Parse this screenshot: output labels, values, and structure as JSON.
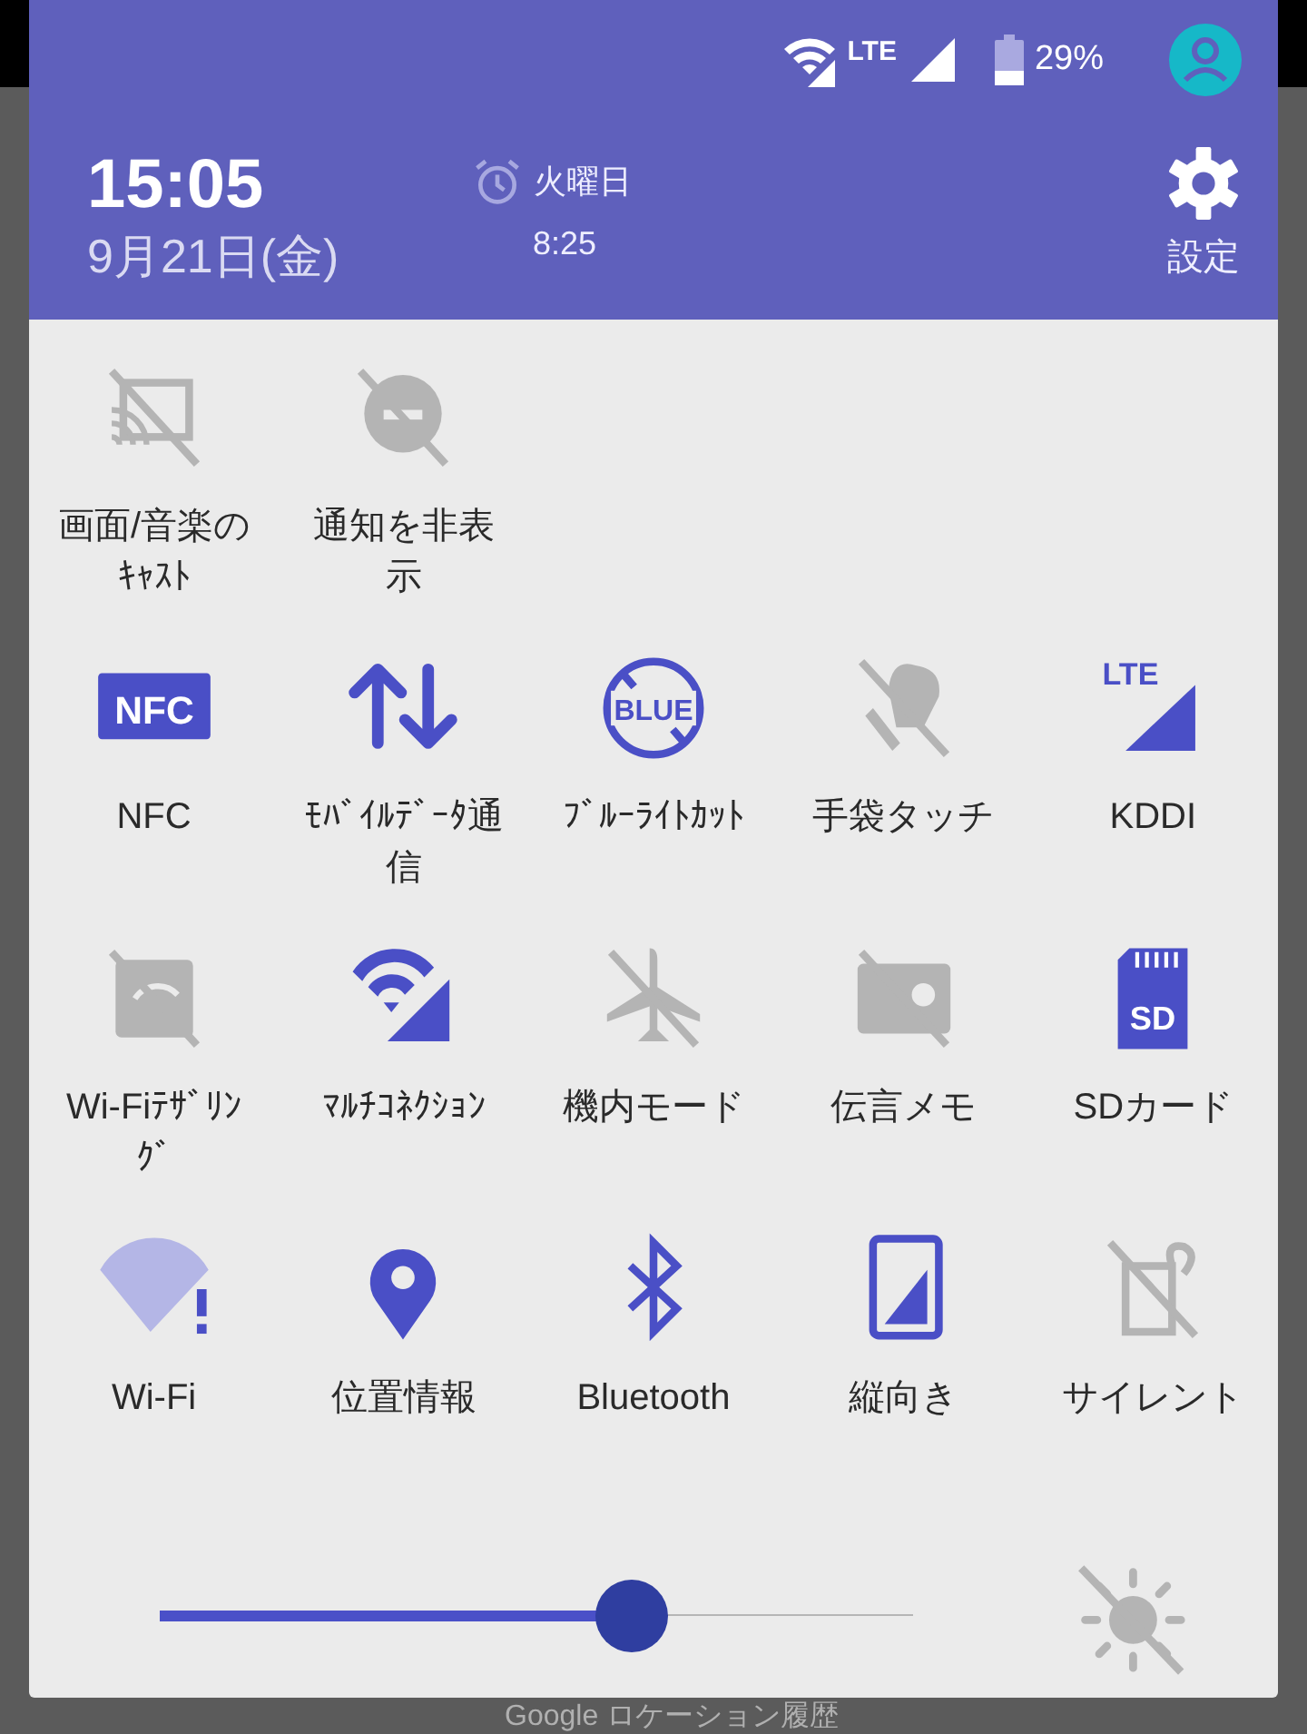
{
  "status_bar": {
    "network_label": "LTE",
    "battery_text": "29%"
  },
  "header": {
    "time": "15:05",
    "date": "9月21日(金)",
    "alarm_day": "火曜日",
    "alarm_time": "8:25",
    "settings_label": "設定"
  },
  "tile_rows": [
    [
      {
        "label": "画面/音楽のｷｬｽﾄ",
        "kind": "cast",
        "on": false
      },
      {
        "label": "通知を非表示",
        "kind": "hide",
        "on": false
      }
    ],
    [
      {
        "label": "NFC",
        "kind": "nfc",
        "on": true,
        "icon_text": "NFC"
      },
      {
        "label": "ﾓﾊﾞｲﾙﾃﾞｰﾀ通信",
        "kind": "data",
        "on": true
      },
      {
        "label": "ﾌﾞﾙｰﾗｲﾄｶｯﾄ",
        "kind": "bluelight",
        "on": true,
        "icon_text": "BLUE"
      },
      {
        "label": "手袋タッチ",
        "kind": "glove",
        "on": false
      },
      {
        "label": "KDDI",
        "kind": "lte",
        "on": true,
        "icon_text": "LTE"
      }
    ],
    [
      {
        "label": "Wi-Fiﾃｻﾞﾘﾝｸﾞ",
        "kind": "tether",
        "on": false
      },
      {
        "label": "ﾏﾙﾁｺﾈｸｼｮﾝ",
        "kind": "multi",
        "on": true
      },
      {
        "label": "機内モード",
        "kind": "airplane",
        "on": false
      },
      {
        "label": "伝言メモ",
        "kind": "voicemail",
        "on": false
      },
      {
        "label": "SDカード",
        "kind": "sd",
        "on": true,
        "icon_text": "SD"
      }
    ],
    [
      {
        "label": "Wi-Fi",
        "kind": "wifi",
        "on": true
      },
      {
        "label": "位置情報",
        "kind": "location",
        "on": true
      },
      {
        "label": "Bluetooth",
        "kind": "bluetooth",
        "on": true
      },
      {
        "label": "縦向き",
        "kind": "rotate",
        "on": true
      },
      {
        "label": "サイレント",
        "kind": "silent",
        "on": false
      }
    ]
  ],
  "brightness": {
    "level": 0.627,
    "auto": false
  },
  "background_app": {
    "item_text": "Google ロケーション履歴"
  }
}
